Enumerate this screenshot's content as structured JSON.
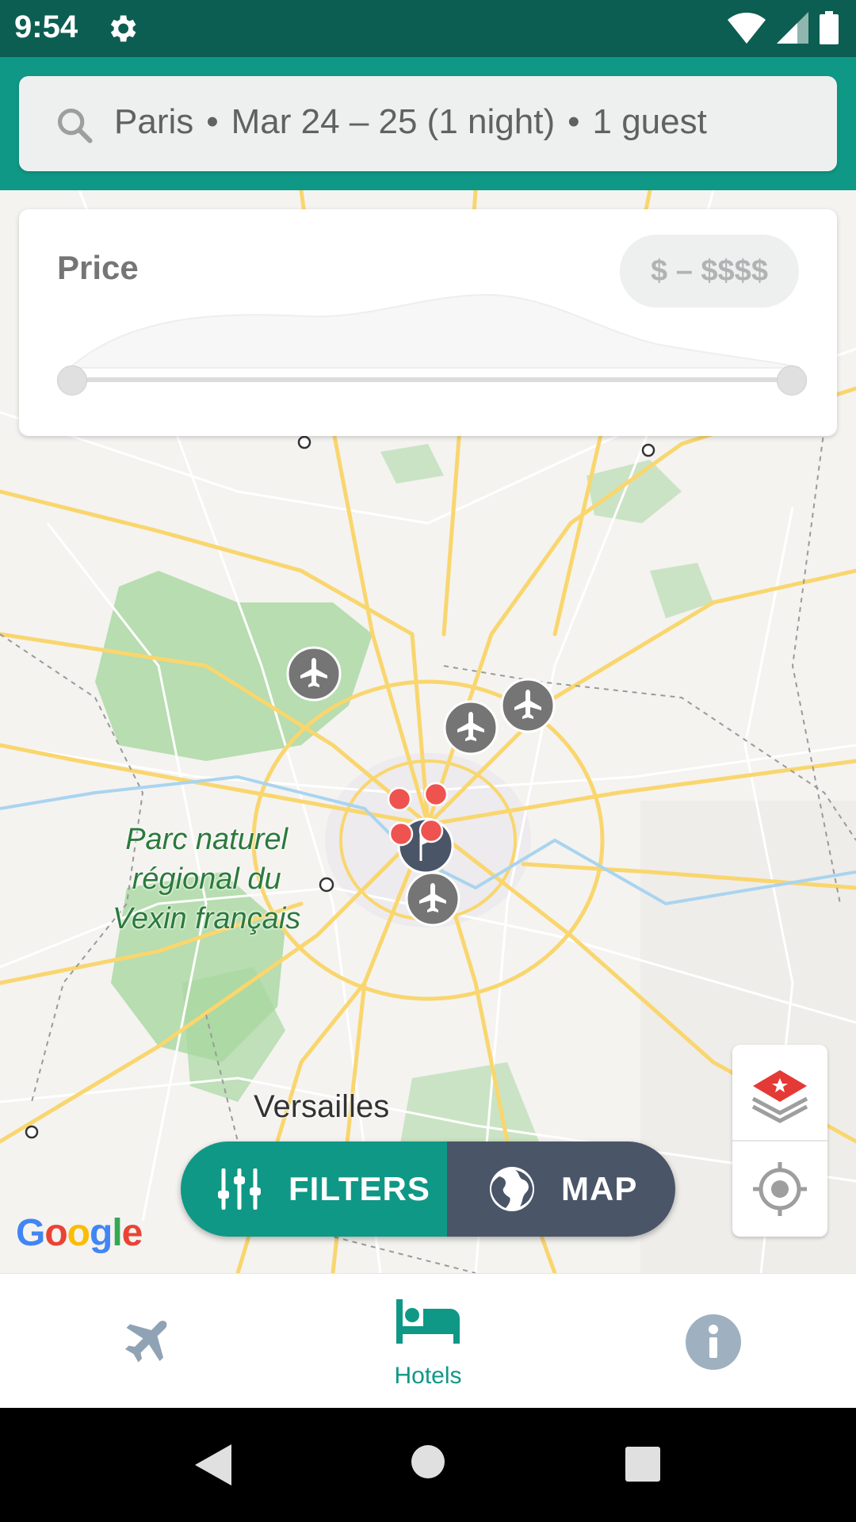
{
  "status_bar": {
    "time": "9:54"
  },
  "search": {
    "city": "Paris",
    "dates": "Mar 24 – 25 (1 night)",
    "guests": "1 guest",
    "separator": "•"
  },
  "price_filter": {
    "label": "Price",
    "range_label": "$ – $$$$",
    "min_fraction": 0.0,
    "max_fraction": 1.0
  },
  "map": {
    "labels": {
      "parc_line1": "Parc naturel",
      "parc_line2": "régional du",
      "parc_line3": "Vexin français",
      "versailles": "Versailles"
    },
    "attribution": "Google",
    "colors": {
      "roads": "#f9d66e",
      "parks": "#a8d7a0",
      "airport_marker": "#757575",
      "hotel_marker": "#ef5350",
      "city_marker": "#4a5568"
    }
  },
  "actions": {
    "filters_label": "FILTERS",
    "map_label": "MAP"
  },
  "bottom_nav": {
    "items": [
      {
        "id": "flights",
        "icon": "airplane-icon",
        "label": ""
      },
      {
        "id": "hotels",
        "icon": "bed-icon",
        "label": "Hotels"
      },
      {
        "id": "info",
        "icon": "info-icon",
        "label": ""
      }
    ],
    "selected": "hotels",
    "accent": "#0f9886"
  }
}
